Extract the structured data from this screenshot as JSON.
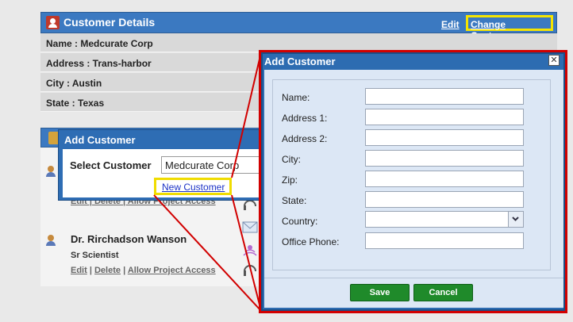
{
  "customer_details": {
    "title": "Customer Details",
    "edit_label": "Edit",
    "change_label": "Change Customer",
    "rows": [
      {
        "text": "Name : Medcurate Corp"
      },
      {
        "text": "Address : Trans-harbor"
      },
      {
        "text": "City : Austin"
      },
      {
        "text": "State : Texas"
      }
    ]
  },
  "small_dialog": {
    "title": "Add Customer",
    "select_label": "Select Customer",
    "select_value": "Medcurate Corp",
    "new_customer_label": "New Customer"
  },
  "contact": {
    "partial_links": "Edit | Delete | Allow Project Access",
    "name": "Dr. Rirchadson Wanson",
    "title": "Sr Scientist",
    "links": [
      "Edit",
      "Delete",
      "Allow Project Access"
    ],
    "separator": " | "
  },
  "add_customer_dialog": {
    "title": "Add Customer",
    "close_glyph": "✕",
    "fields": {
      "name": "Name:",
      "address1": "Address 1:",
      "address2": "Address 2:",
      "city": "City:",
      "zip": "Zip:",
      "state": "State:",
      "country": "Country:",
      "office_phone": "Office Phone:"
    },
    "select_arrow": "⌄",
    "save_label": "Save",
    "cancel_label": "Cancel"
  },
  "icons": {
    "customer": "customer-icon",
    "book": "address-book-icon",
    "contact": "person-icon",
    "email": "email-icon",
    "phone": "headset-icon",
    "signal": "broadcast-icon"
  },
  "colors": {
    "header_blue": "#3b79c1",
    "highlight_yellow": "#f5e400",
    "callout_red": "#d10000",
    "button_green": "#1f8a2a"
  }
}
